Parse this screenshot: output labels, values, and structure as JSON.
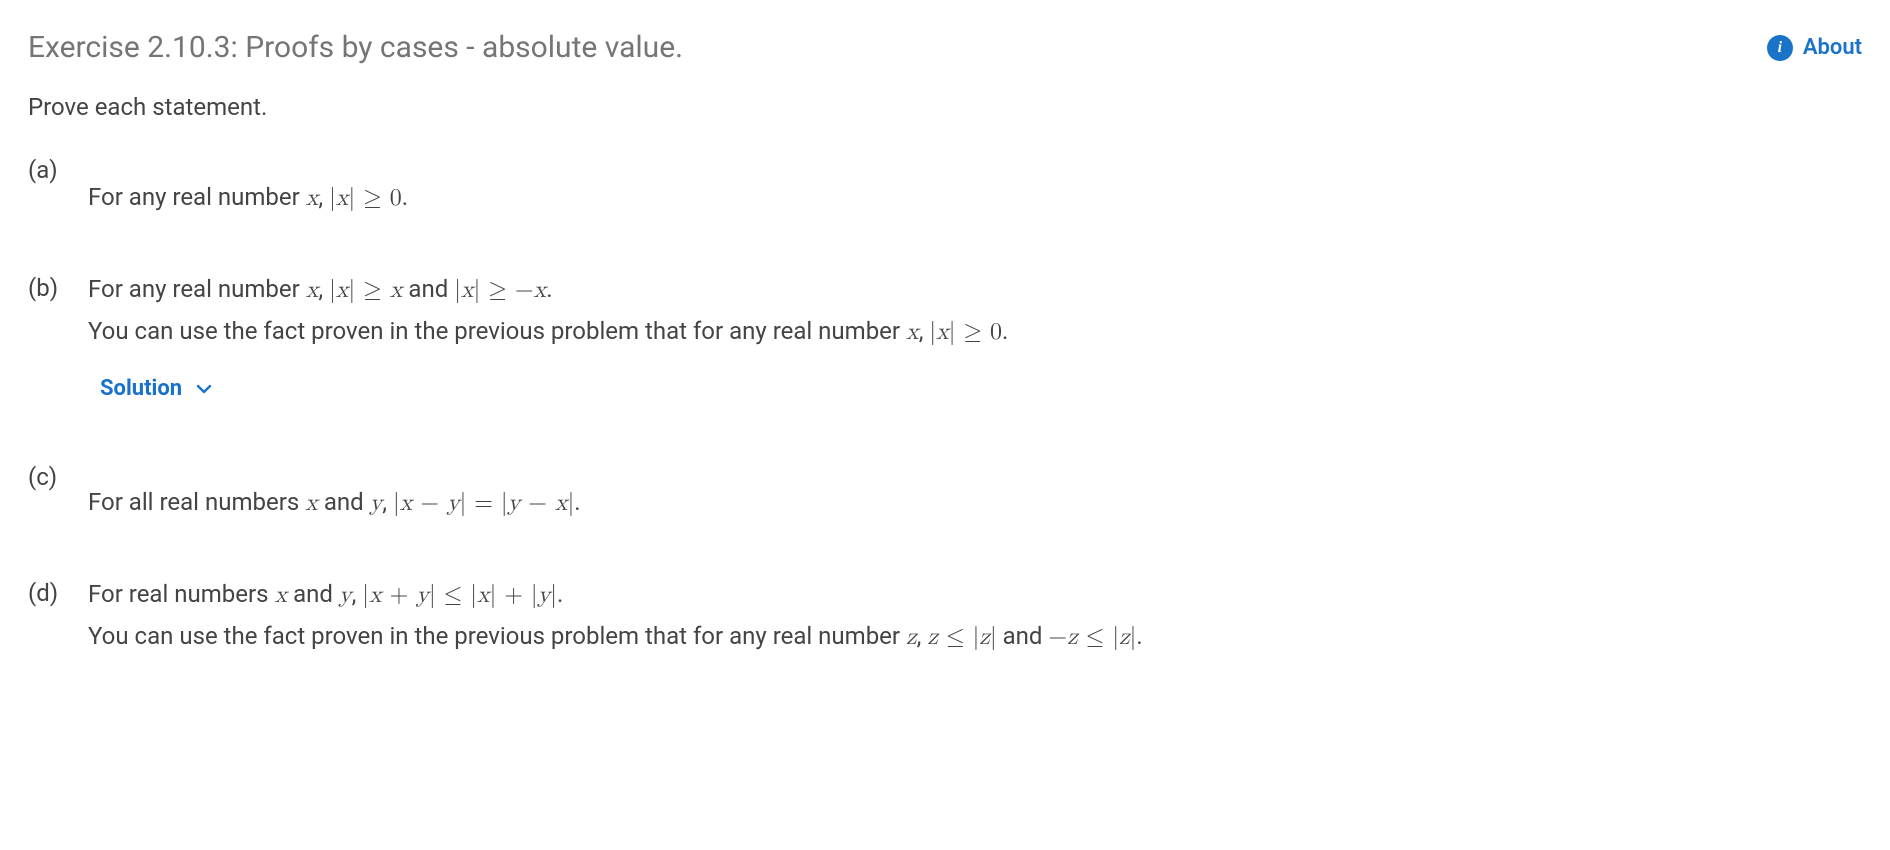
{
  "header": {
    "title": "Exercise 2.10.3: Proofs by cases - absolute value.",
    "about_label": "About"
  },
  "instruction": "Prove each statement.",
  "problems": {
    "a": {
      "label": "(a)",
      "text_prefix": "For any real number ",
      "var_x": "x",
      "text_mid": ", ",
      "expr": "|x| ≥ 0",
      "text_suffix": "."
    },
    "b": {
      "label": "(b)",
      "line1_prefix": "For any real number ",
      "var_x": "x",
      "mid1": ", ",
      "expr1": "|x| ≥ x",
      "and_word": " and ",
      "expr2": "|x| ≥ −x",
      "end1": ".",
      "line2_prefix": "You can use the fact proven in the previous problem that for any real number ",
      "var_x2": "x",
      "mid2": ", ",
      "expr3": "|x| ≥ 0",
      "end2": ".",
      "solution_label": "Solution"
    },
    "c": {
      "label": "(c)",
      "text_prefix": "For all real numbers ",
      "var_x": "x",
      "and_word": " and ",
      "var_y": "y",
      "mid": ", ",
      "expr": "|x − y| = |y − x|",
      "end": "."
    },
    "d": {
      "label": "(d)",
      "line1_prefix": "For real numbers ",
      "var_x": "x",
      "and_word": " and ",
      "var_y": "y",
      "mid1": ", ",
      "expr1": "|x + y| ≤ |x| + |y|",
      "end1": ".",
      "line2_prefix": "You can use the fact proven in the previous problem that for any real number ",
      "var_z": "z",
      "mid2": ", ",
      "expr2": "z ≤ |z|",
      "and_word2": " and ",
      "expr3": "−z ≤ |z|",
      "end2": "."
    }
  }
}
